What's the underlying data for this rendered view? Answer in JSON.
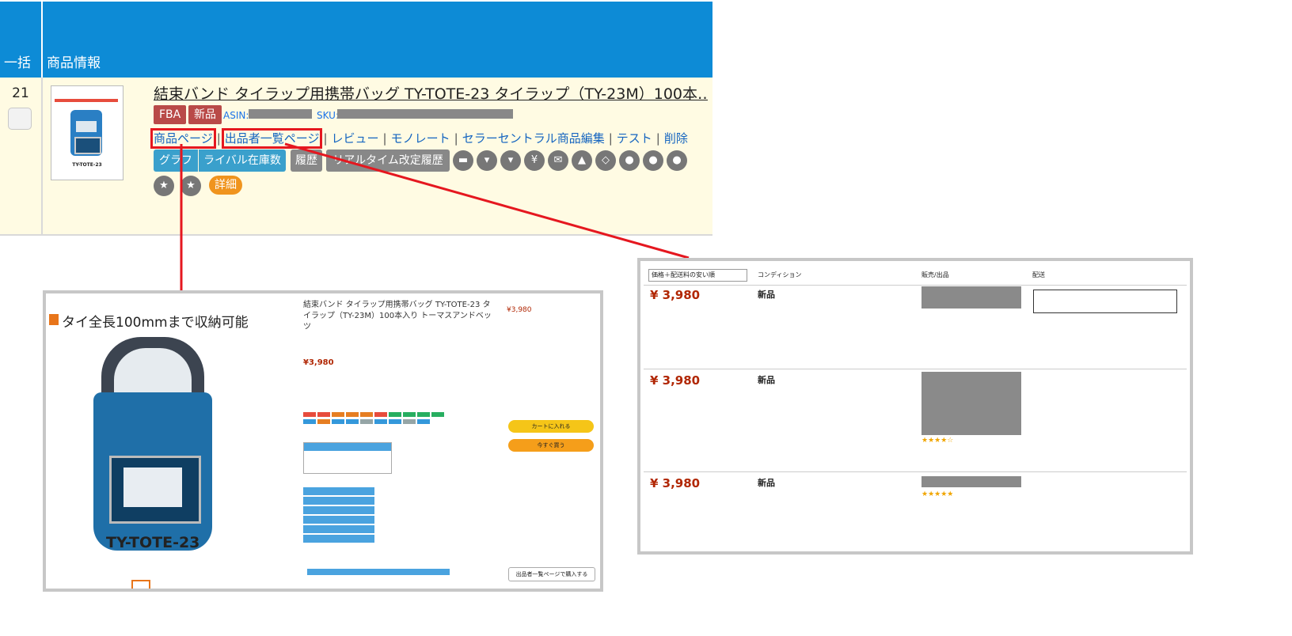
{
  "table": {
    "header_bulk": "一括",
    "header_product_info": "商品情報"
  },
  "row": {
    "number": "21",
    "title": "結束バンド タイラップ用携帯バッグ TY-TOTE-23 タイラップ（TY-23M）100本…",
    "badge_fba": "FBA",
    "badge_new": "新品",
    "asin_label": "ASIN:",
    "sku_label": "SKU:",
    "links": [
      "商品ページ",
      "出品者一覧ページ",
      "レビュー",
      "モノレート",
      "セラーセントラル商品編集",
      "テスト",
      "削除"
    ],
    "buttons": {
      "graph": "グラフ",
      "rival_stock": "ライバル在庫数",
      "history": "履歴",
      "realtime_history": "リアルタイム改定履歴"
    },
    "detail": "詳細",
    "thumb_caption": "TY-TOTE-23"
  },
  "product_page": {
    "image_heading": "タイ全長100mmまで収納可能",
    "image_model": "TY-TOTE-23",
    "title": "結束バンド タイラップ用携帯バッグ TY-TOTE-23 タイラップ（TY-23M）100本入り トーマスアンドベッツ",
    "price": "¥3,980",
    "price_right": "¥3,980",
    "cart_button": "カートに入れる",
    "buy_button": "今すぐ買う",
    "footer_button": "出品者一覧ページで購入する"
  },
  "sellers_page": {
    "col_sort": "価格＋配送料の安い順",
    "col_condition": "コンディション",
    "col_seller": "販売/出品",
    "col_shipping": "配送",
    "offers": [
      {
        "price": "¥ 3,980",
        "condition": "新品"
      },
      {
        "price": "¥ 3,980",
        "condition": "新品"
      },
      {
        "price": "¥ 3,980",
        "condition": "新品"
      }
    ]
  },
  "colors": {
    "header": "#0d8bd6",
    "row_bg": "#fffbe3",
    "highlight": "#e5171f",
    "teal": "#3aa0cc",
    "orange": "#f0941e"
  }
}
